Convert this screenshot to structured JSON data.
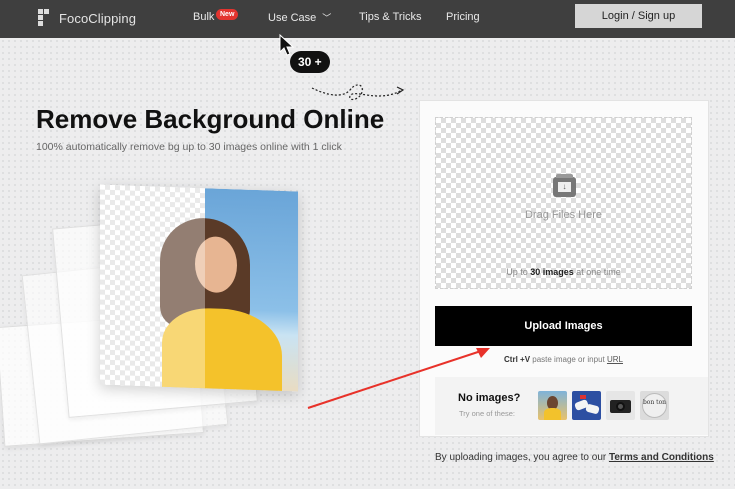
{
  "nav": {
    "brand": "FocoClipping",
    "items": [
      {
        "label": "Bulk",
        "badge": "New"
      },
      {
        "label": "Use Case",
        "has_dropdown": true
      },
      {
        "label": "Tips & Tricks"
      },
      {
        "label": "Pricing"
      }
    ],
    "login_label": "Login / Sign up"
  },
  "hero": {
    "title": "Remove Background Online",
    "subtitle": "100% automatically remove bg up to 30 images online with 1 click",
    "badge": "30 +"
  },
  "upload": {
    "drop_text": "Drag Files Here",
    "limit_prefix": "Up to ",
    "limit_bold": "30 images",
    "limit_suffix": " at one time",
    "button_label": "Upload Images",
    "paste_key": "Ctrl +V",
    "paste_text": " paste image or input ",
    "paste_link": "URL",
    "no_images_title": "No images?",
    "no_images_sub": "Try one of these:",
    "samples": [
      "sample-woman",
      "sample-sneakers",
      "sample-camera",
      "sample-bonton-logo"
    ],
    "sample_4_text": "bon ton",
    "terms_prefix": "By uploading images, you agree to our ",
    "terms_link": "Terms and Conditions"
  },
  "colors": {
    "nav_bg": "#3f3f3f",
    "badge_red": "#e3342f",
    "upload_button": "#000000",
    "annotation_arrow": "#e8322a"
  }
}
